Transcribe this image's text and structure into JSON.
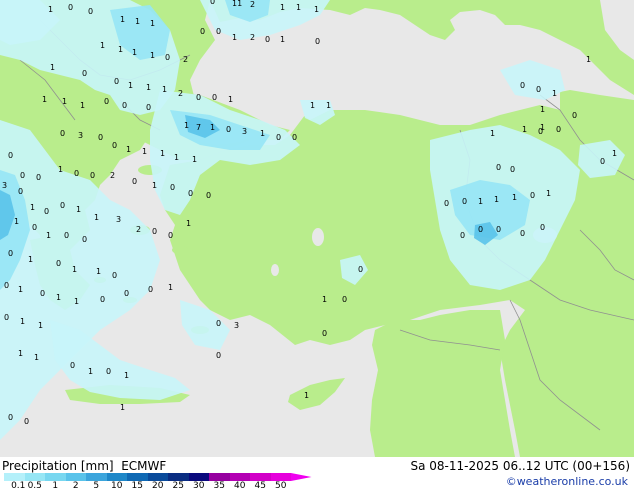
{
  "title": {
    "product": "Precipitation [mm]",
    "model": "ECMWF",
    "valid_time": "Sa 08-11-2025 06..12 UTC (00+156)"
  },
  "copyright": "©weatheronline.co.uk",
  "legend": {
    "labels": [
      "0.1",
      "0.5",
      "1",
      "2",
      "5",
      "10",
      "15",
      "20",
      "25",
      "30",
      "35",
      "40",
      "45",
      "50"
    ],
    "colors": [
      "#b4f0fa",
      "#96e6f5",
      "#78d7f0",
      "#5ac3ea",
      "#3ca5dc",
      "#1e87c8",
      "#0f69b4",
      "#0a4b9b",
      "#0a2d82",
      "#0a0a7d",
      "#9600a0",
      "#b400b4",
      "#d200c8",
      "#e600dc",
      "#f000f0"
    ]
  },
  "colors": {
    "land": "#b9ed8c",
    "sea": "#e8e8e8",
    "light_rain": "#c8f5fa",
    "moderate_rain": "#96e6f5",
    "heavy_rain": "#5ac3ea"
  },
  "rain_values": [
    "1",
    "1",
    "1",
    "0",
    "11",
    "2",
    "1",
    "1",
    "1",
    "0",
    "0",
    "1",
    "2",
    "0",
    "1",
    "0",
    "1",
    "1",
    "1",
    "1",
    "0",
    "2",
    "1",
    "0",
    "0",
    "1",
    "1",
    "1",
    "2",
    "0",
    "0",
    "1",
    "1",
    "1",
    "1",
    "0",
    "0",
    "0",
    "1",
    "7",
    "1",
    "0",
    "3",
    "1",
    "0",
    "0",
    "0",
    "3",
    "0",
    "0",
    "1",
    "1",
    "1",
    "1",
    "1",
    "0",
    "0",
    "0",
    "1",
    "0",
    "0",
    "2",
    "0",
    "1",
    "0",
    "0",
    "0",
    "3",
    "0",
    "1",
    "0",
    "0",
    "1",
    "1",
    "3",
    "2",
    "0",
    "0",
    "1",
    "1",
    "0",
    "1",
    "0",
    "0",
    "0",
    "1",
    "0",
    "1",
    "1",
    "0",
    "0",
    "1",
    "0",
    "1",
    "1",
    "0",
    "0",
    "0",
    "1",
    "0",
    "1",
    "1",
    "1",
    "1",
    "0",
    "1",
    "0",
    "1",
    "0",
    "0",
    "1",
    "0",
    "3",
    "0",
    "1",
    "1",
    "0",
    "0",
    "0",
    "0",
    "0",
    "1",
    "1",
    "1",
    "0",
    "1",
    "0",
    "0",
    "0",
    "0",
    "0",
    "1",
    "1",
    "1",
    "0",
    "0",
    "0",
    "1",
    "0",
    "1",
    "0",
    "0",
    "0",
    "1",
    "1",
    "0",
    "0",
    "1",
    "1",
    "1",
    "0"
  ]
}
